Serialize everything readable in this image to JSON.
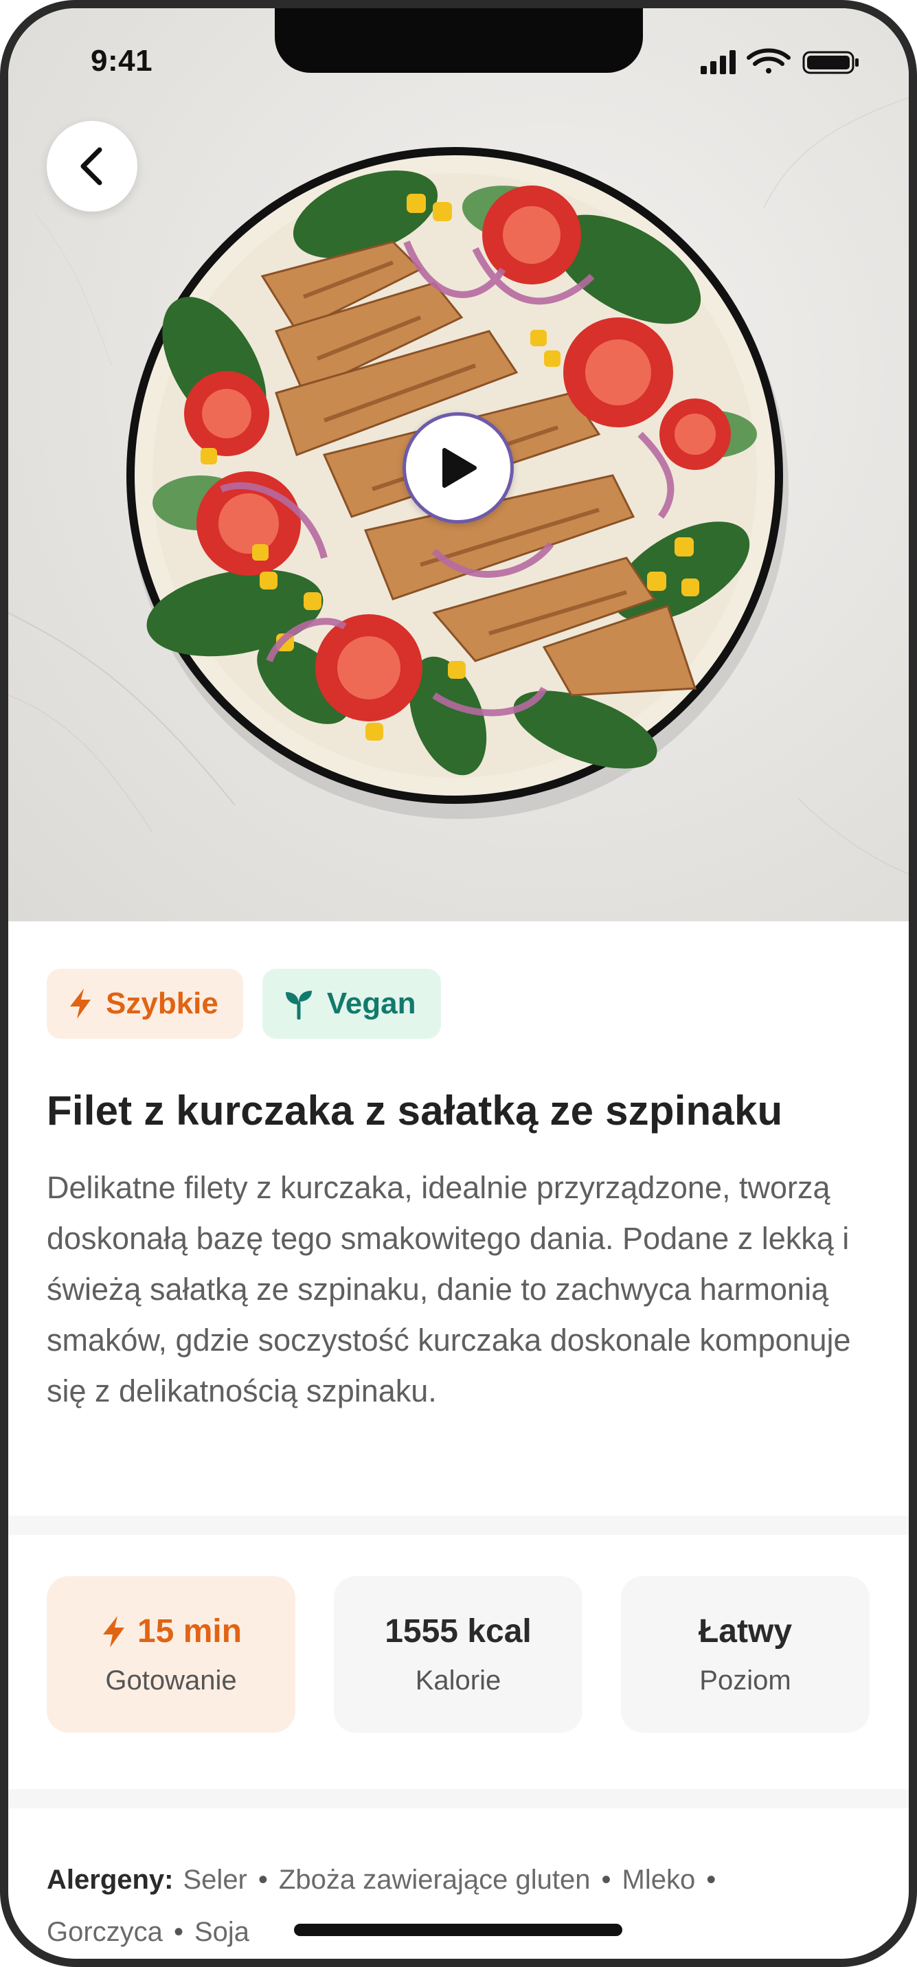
{
  "status_bar": {
    "time": "9:41"
  },
  "hero": {
    "image": "grilled chicken fillet with spinach salad, tomatoes, corn and red onion on a plate"
  },
  "tags": [
    {
      "label": "Szybkie",
      "icon": "lightning-icon",
      "color": "#e06414"
    },
    {
      "label": "Vegan",
      "icon": "sprout-icon",
      "color": "#127a6c"
    }
  ],
  "recipe": {
    "title": "Filet z kurczaka z sałatką ze szpinaku",
    "description": "Delikatne filety z kurczaka, idealnie przyrządzone, tworzą doskonałą bazę tego smakowitego dania. Podane z lekką i świeżą sałatką ze szpinaku, danie to zachwyca harmonią smaków, gdzie soczystość kurczaka doskonale komponuje się z delikatnością szpinaku."
  },
  "stats": [
    {
      "value": "15 min",
      "label": "Gotowanie",
      "icon": "lightning-icon"
    },
    {
      "value": "1555 kcal",
      "label": "Kalorie"
    },
    {
      "value": "Łatwy",
      "label": "Poziom"
    }
  ],
  "allergens": {
    "label": "Alergeny:",
    "items": [
      "Seler",
      "Zboża zawierające gluten",
      "Mleko",
      "Gorczyca",
      "Soja"
    ]
  },
  "colors": {
    "accent_orange": "#e06414",
    "accent_green": "#127a6c",
    "play_ring": "#6e5aa9"
  }
}
